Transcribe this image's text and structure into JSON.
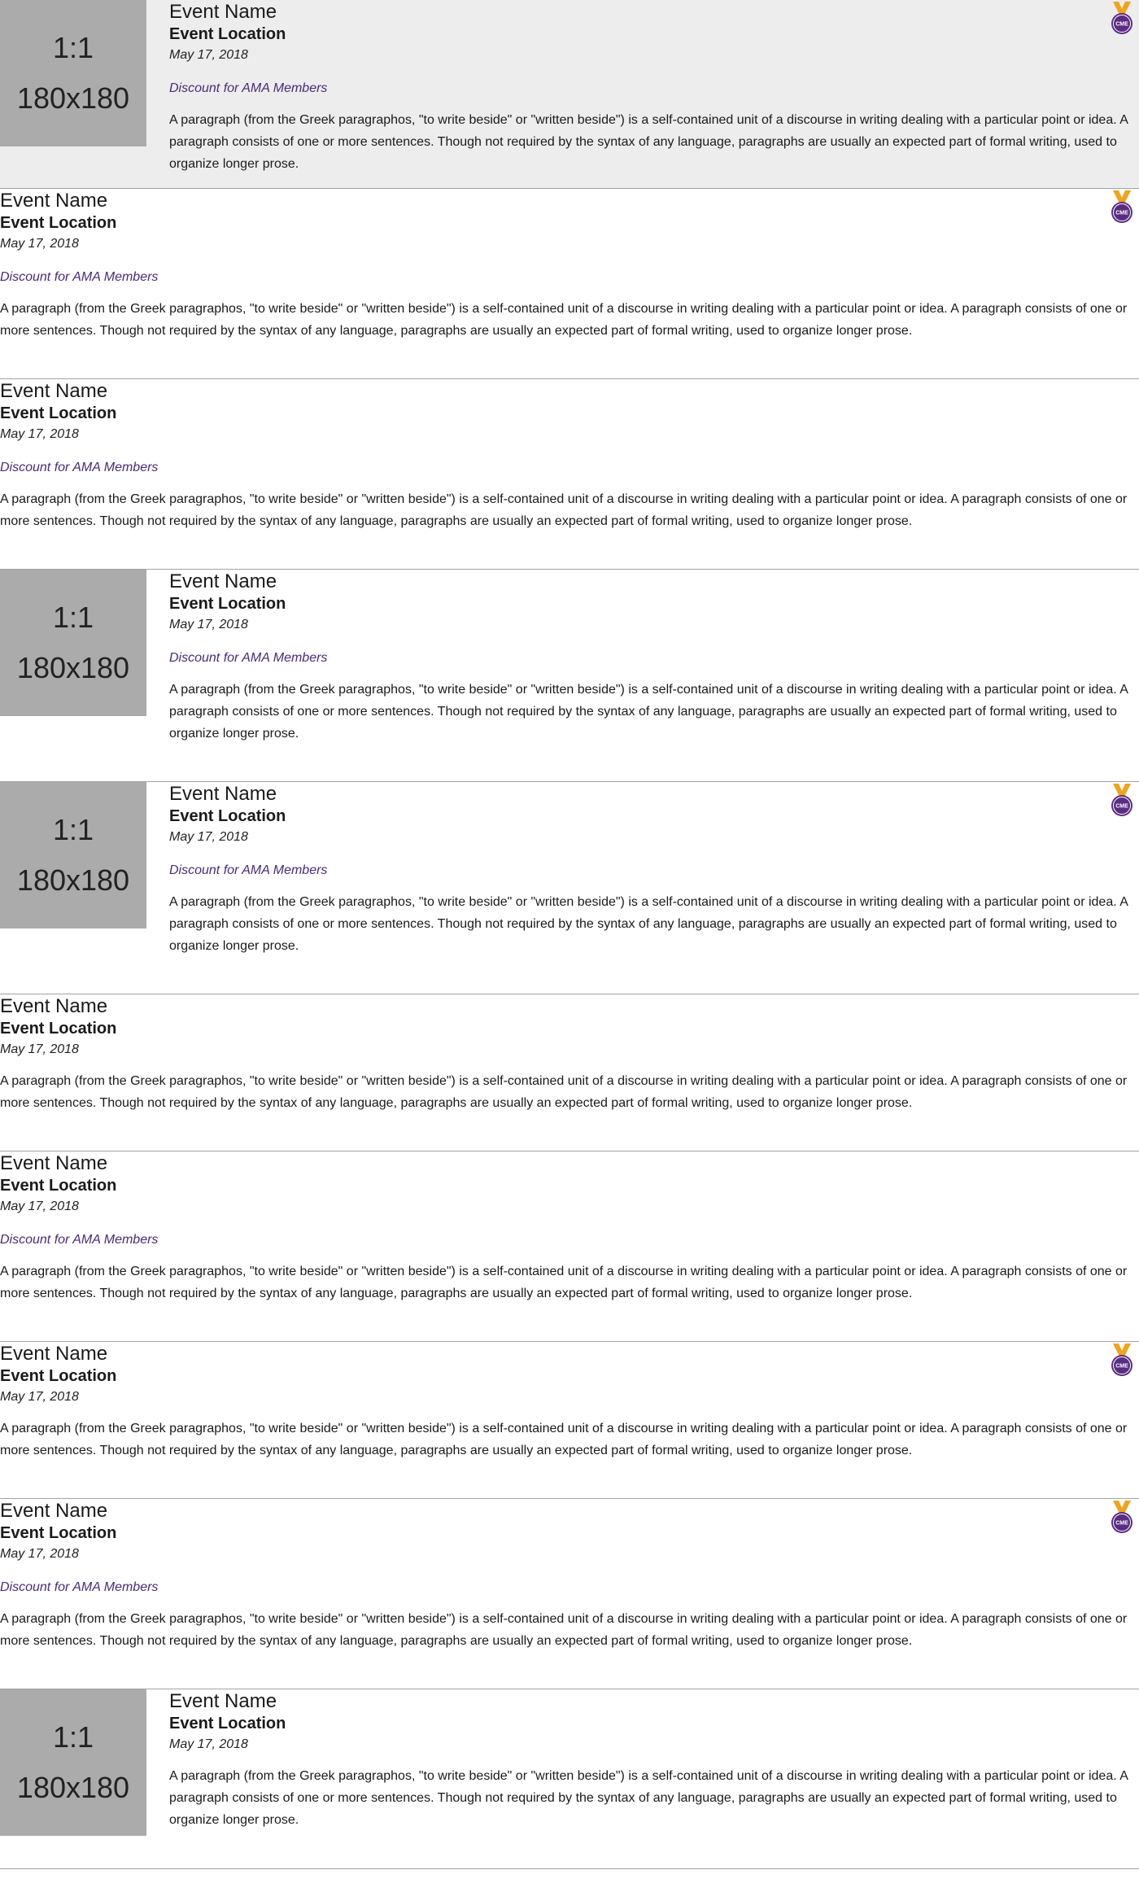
{
  "placeholder": {
    "ratio": "1:1",
    "size": "180x180"
  },
  "badge_icon": "cme-medal-icon",
  "colors": {
    "highlight_bg": "#ededed",
    "discount_text": "#4a2a7a",
    "badge_purple": "#5a2d82",
    "badge_gold": "#f0a31b",
    "divider": "#a3a3a3"
  },
  "events": [
    {
      "name": "Event Name",
      "location": "Event Location",
      "date": "May 17, 2018",
      "discount": "Discount for AMA Members",
      "description": "A paragraph (from the Greek paragraphos, \"to write beside\" or \"written beside\") is a self-contained unit of a discourse in writing dealing with a particular point or idea. A paragraph consists of one or more sentences. Though not required by the syntax of any language, paragraphs are usually an expected part of formal writing, used to organize longer prose.",
      "has_image": true,
      "has_badge": true,
      "highlighted": true,
      "badge_text": "CME"
    },
    {
      "name": "Event Name",
      "location": "Event Location",
      "date": "May 17, 2018",
      "discount": "Discount for AMA Members",
      "description": "A paragraph (from the Greek paragraphos, \"to write beside\" or \"written beside\") is a self-contained unit of a discourse in writing dealing with a particular point or idea. A paragraph consists of one or more sentences. Though not required by the syntax of any language, paragraphs are usually an expected part of formal writing, used to organize longer prose.",
      "has_image": false,
      "has_badge": true,
      "highlighted": false,
      "badge_text": "CME"
    },
    {
      "name": "Event Name",
      "location": "Event Location",
      "date": "May 17, 2018",
      "discount": "Discount for AMA Members",
      "description": "A paragraph (from the Greek paragraphos, \"to write beside\" or \"written beside\") is a self-contained unit of a discourse in writing dealing with a particular point or idea. A paragraph consists of one or more sentences. Though not required by the syntax of any language, paragraphs are usually an expected part of formal writing, used to organize longer prose.",
      "has_image": false,
      "has_badge": false,
      "highlighted": false
    },
    {
      "name": "Event Name",
      "location": "Event Location",
      "date": "May 17, 2018",
      "discount": "Discount for AMA Members",
      "description": "A paragraph (from the Greek paragraphos, \"to write beside\" or \"written beside\") is a self-contained unit of a discourse in writing dealing with a particular point or idea. A paragraph consists of one or more sentences. Though not required by the syntax of any language, paragraphs are usually an expected part of formal writing, used to organize longer prose.",
      "has_image": true,
      "has_badge": false,
      "highlighted": false
    },
    {
      "name": "Event Name",
      "location": "Event Location",
      "date": "May 17, 2018",
      "discount": "Discount for AMA Members",
      "description": "A paragraph (from the Greek paragraphos, \"to write beside\" or \"written beside\") is a self-contained unit of a discourse in writing dealing with a particular point or idea. A paragraph consists of one or more sentences. Though not required by the syntax of any language, paragraphs are usually an expected part of formal writing, used to organize longer prose.",
      "has_image": true,
      "has_badge": true,
      "highlighted": false,
      "badge_text": "CME"
    },
    {
      "name": "Event Name",
      "location": "Event Location",
      "date": "May 17, 2018",
      "discount": null,
      "description": "A paragraph (from the Greek paragraphos, \"to write beside\" or \"written beside\") is a self-contained unit of a discourse in writing dealing with a particular point or idea. A paragraph consists of one or more sentences. Though not required by the syntax of any language, paragraphs are usually an expected part of formal writing, used to organize longer prose.",
      "has_image": false,
      "has_badge": false,
      "highlighted": false
    },
    {
      "name": "Event Name",
      "location": "Event Location",
      "date": "May 17, 2018",
      "discount": "Discount for AMA Members",
      "description": "A paragraph (from the Greek paragraphos, \"to write beside\" or \"written beside\") is a self-contained unit of a discourse in writing dealing with a particular point or idea. A paragraph consists of one or more sentences. Though not required by the syntax of any language, paragraphs are usually an expected part of formal writing, used to organize longer prose.",
      "has_image": false,
      "has_badge": false,
      "highlighted": false
    },
    {
      "name": "Event Name",
      "location": "Event Location",
      "date": "May 17, 2018",
      "discount": null,
      "description": "A paragraph (from the Greek paragraphos, \"to write beside\" or \"written beside\") is a self-contained unit of a discourse in writing dealing with a particular point or idea. A paragraph consists of one or more sentences. Though not required by the syntax of any language, paragraphs are usually an expected part of formal writing, used to organize longer prose.",
      "has_image": false,
      "has_badge": true,
      "highlighted": false,
      "badge_text": "CME"
    },
    {
      "name": "Event Name",
      "location": "Event Location",
      "date": "May 17, 2018",
      "discount": "Discount for AMA Members",
      "description": "A paragraph (from the Greek paragraphos, \"to write beside\" or \"written beside\") is a self-contained unit of a discourse in writing dealing with a particular point or idea. A paragraph consists of one or more sentences. Though not required by the syntax of any language, paragraphs are usually an expected part of formal writing, used to organize longer prose.",
      "has_image": false,
      "has_badge": true,
      "highlighted": false,
      "badge_text": "CME"
    },
    {
      "name": "Event Name",
      "location": "Event Location",
      "date": "May 17, 2018",
      "discount": null,
      "description": "A paragraph (from the Greek paragraphos, \"to write beside\" or \"written beside\") is a self-contained unit of a discourse in writing dealing with a particular point or idea. A paragraph consists of one or more sentences. Though not required by the syntax of any language, paragraphs are usually an expected part of formal writing, used to organize longer prose.",
      "has_image": true,
      "has_badge": false,
      "highlighted": false
    }
  ]
}
